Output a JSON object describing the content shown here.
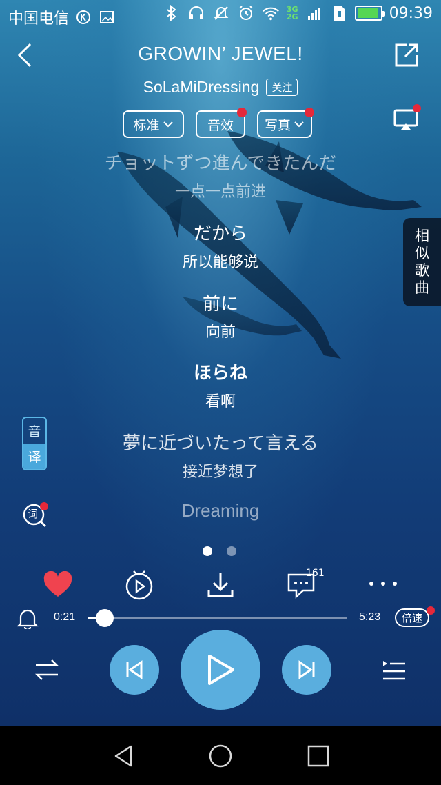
{
  "status_bar": {
    "carrier": "中国电信",
    "network_top": "3G",
    "network_bottom": "2G",
    "time": "09:39"
  },
  "header": {
    "title": "GROWIN’ JEWEL!",
    "artist": "SoLaMiDressing",
    "follow_label": "关注"
  },
  "options": {
    "quality_label": "标准",
    "effect_label": "音效",
    "photo_label": "写真"
  },
  "similar_songs": [
    "相",
    "似",
    "歌",
    "曲"
  ],
  "lyrics": [
    {
      "original": "チョットずつ進んできたんだ",
      "translation": "一点一点前进"
    },
    {
      "original": "だから",
      "translation": "所以能够说"
    },
    {
      "original": "前に",
      "translation": "向前"
    },
    {
      "original": "ほらね",
      "translation": "看啊"
    },
    {
      "original": "夢に近づいたって言える",
      "translation": "接近梦想了"
    },
    {
      "original": "Dreaming",
      "translation": ""
    }
  ],
  "lyric_toggle": {
    "top": "音",
    "bottom": "译"
  },
  "lyric_search_icon_label": "词",
  "actions": {
    "comment_count": "161"
  },
  "player": {
    "current_time": "0:21",
    "total_time": "5:23",
    "progress_fraction": 0.065,
    "speed_label": "倍速"
  },
  "colors": {
    "accent": "#5aaede",
    "like": "#f0434f",
    "badge": "#e5283a"
  }
}
